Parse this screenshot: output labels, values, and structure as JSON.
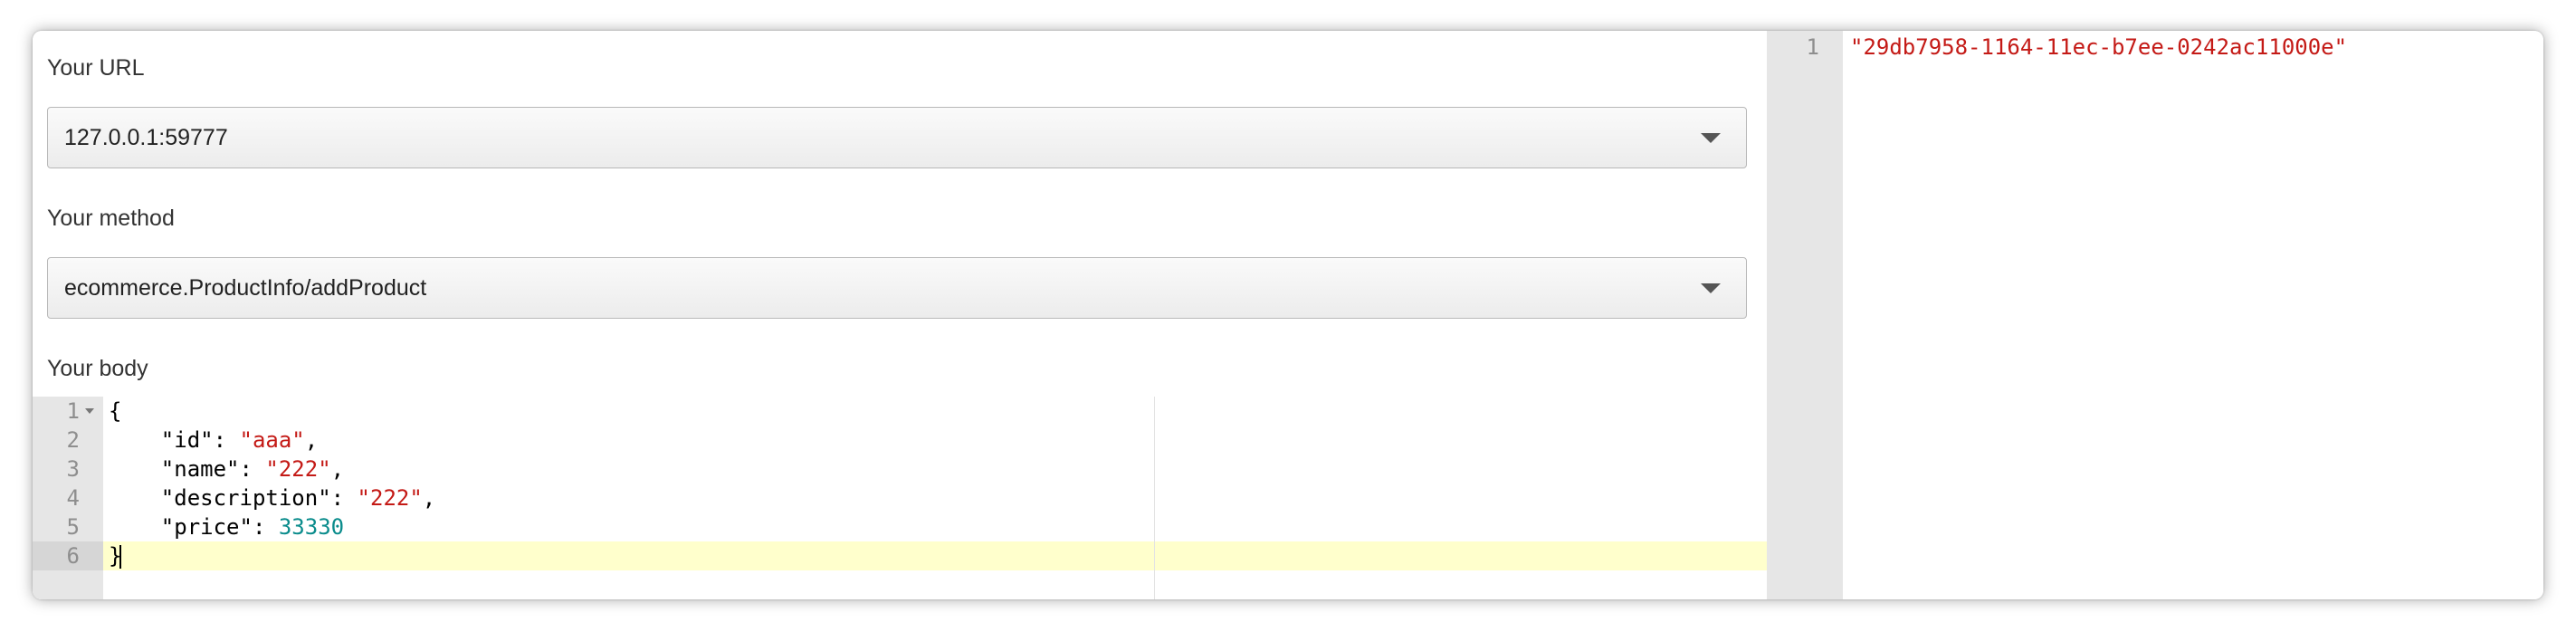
{
  "url_field": {
    "label": "Your URL",
    "value": "127.0.0.1:59777"
  },
  "method_field": {
    "label": "Your method",
    "value": "ecommerce.ProductInfo/addProduct"
  },
  "body_field": {
    "label": "Your body",
    "line_numbers": [
      "1",
      "2",
      "3",
      "4",
      "5",
      "6"
    ],
    "lines": [
      [
        {
          "t": "punc",
          "v": "{"
        }
      ],
      [
        {
          "t": "key",
          "v": "    \"id\""
        },
        {
          "t": "punc",
          "v": ": "
        },
        {
          "t": "str",
          "v": "\"aaa\""
        },
        {
          "t": "punc",
          "v": ","
        }
      ],
      [
        {
          "t": "key",
          "v": "    \"name\""
        },
        {
          "t": "punc",
          "v": ": "
        },
        {
          "t": "str",
          "v": "\"222\""
        },
        {
          "t": "punc",
          "v": ","
        }
      ],
      [
        {
          "t": "key",
          "v": "    \"description\""
        },
        {
          "t": "punc",
          "v": ": "
        },
        {
          "t": "str",
          "v": "\"222\""
        },
        {
          "t": "punc",
          "v": ","
        }
      ],
      [
        {
          "t": "key",
          "v": "    \"price\""
        },
        {
          "t": "punc",
          "v": ": "
        },
        {
          "t": "num",
          "v": "33330"
        }
      ],
      [
        {
          "t": "punc",
          "v": "}"
        }
      ]
    ],
    "active_line": 6
  },
  "response": {
    "line_numbers": [
      "1"
    ],
    "lines": [
      "\"29db7958-1164-11ec-b7ee-0242ac11000e\""
    ]
  },
  "icons": {
    "select_caret": "caret-down-icon",
    "fold": "fold-arrow-icon"
  },
  "colors": {
    "string": "#c41a16",
    "number": "#0a8c8c",
    "active_line": "#ffffcc",
    "gutter": "#e6e6e6"
  }
}
